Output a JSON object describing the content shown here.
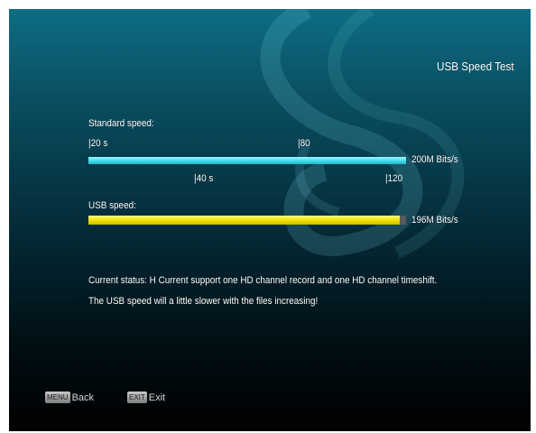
{
  "page": {
    "title": "USB Speed Test"
  },
  "standard": {
    "label": "Standard speed:",
    "ticks": {
      "t20": "|20 s",
      "t80": "|80",
      "t40": "|40 s",
      "t120": "|120"
    },
    "value_text": "200M Bits/s",
    "fill_fraction": 1.0
  },
  "usb": {
    "label": "USB speed:",
    "value_text": "196M Bits/s",
    "fill_fraction": 0.98
  },
  "status": {
    "line1": "Current status: H Current support one HD channel record and one HD channel timeshift.",
    "line2": "The USB speed will a little slower with the files increasing!"
  },
  "keys": {
    "menu_badge": "MENU",
    "menu_label": "Back",
    "exit_badge": "EXIT",
    "exit_label": "Exit"
  },
  "colors": {
    "standard_bar": "#45dff0",
    "usb_bar": "#f1e400",
    "background_top": "#0d6d84",
    "background_bottom": "#000000"
  }
}
